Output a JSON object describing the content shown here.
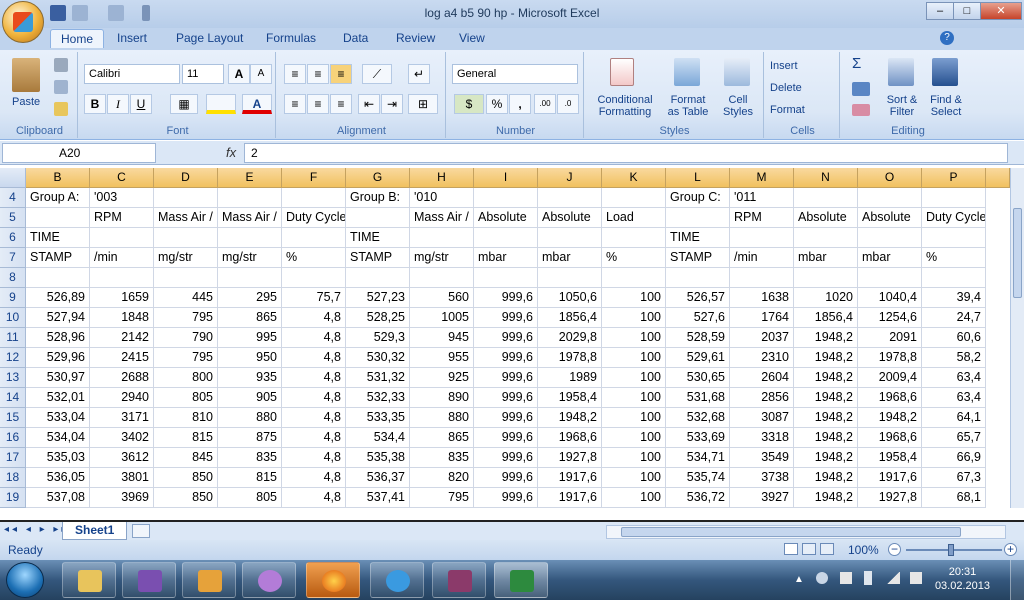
{
  "window": {
    "title": "log a4 b5 90 hp  -  Microsoft Excel",
    "min": "–",
    "max": "□",
    "close": "✕"
  },
  "tabs": [
    "Home",
    "Insert",
    "Page Layout",
    "Formulas",
    "Data",
    "Review",
    "View"
  ],
  "ribbon": {
    "clipboard": {
      "label": "Clipboard",
      "paste": "Paste"
    },
    "font": {
      "label": "Font",
      "name": "Calibri",
      "size": "11",
      "bold": "B",
      "italic": "I",
      "underline": "U",
      "grow": "A",
      "shrink": "A"
    },
    "alignment": {
      "label": "Alignment"
    },
    "number": {
      "label": "Number",
      "format": "General",
      "percent": "%",
      "comma": ","
    },
    "styles": {
      "label": "Styles",
      "conditional": "Conditional",
      "conditional2": "Formatting",
      "format_table": "Format",
      "format_table2": "as Table",
      "cell_styles": "Cell",
      "cell_styles2": "Styles"
    },
    "cells": {
      "label": "Cells",
      "insert": "Insert",
      "delete": "Delete",
      "format": "Format"
    },
    "editing": {
      "label": "Editing",
      "sum": "Σ",
      "sort": "Sort &",
      "sort2": "Filter",
      "find": "Find &",
      "find2": "Select"
    }
  },
  "formula_bar": {
    "name_box": "A20",
    "fx": "fx",
    "value": "2"
  },
  "columns": [
    "B",
    "C",
    "D",
    "E",
    "F",
    "G",
    "H",
    "I",
    "J",
    "K",
    "L",
    "M",
    "N",
    "O",
    "P"
  ],
  "rows": [
    {
      "n": "4",
      "cells": [
        "Group A:",
        "'003",
        "",
        "",
        "",
        "Group B:",
        "'010",
        "",
        "",
        "",
        "Group C:",
        "'011",
        "",
        "",
        ""
      ]
    },
    {
      "n": "5",
      "cells": [
        "",
        "RPM",
        "Mass Air /",
        "Mass Air /",
        "Duty Cycle",
        "",
        "Mass Air /",
        "Absolute",
        "Absolute",
        "Load",
        "",
        "RPM",
        "Absolute",
        "Absolute",
        "Duty Cycle"
      ]
    },
    {
      "n": "6",
      "cells": [
        "TIME",
        "",
        "",
        "",
        "",
        "TIME",
        "",
        "",
        "",
        "",
        "TIME",
        "",
        "",
        "",
        ""
      ]
    },
    {
      "n": "7",
      "cells": [
        "STAMP",
        "/min",
        "mg/str",
        "mg/str",
        "%",
        "STAMP",
        "mg/str",
        "mbar",
        "mbar",
        "%",
        "STAMP",
        "/min",
        "mbar",
        "mbar",
        "%"
      ]
    },
    {
      "n": "8",
      "cells": [
        "",
        "",
        "",
        "",
        "",
        "",
        "",
        "",
        "",
        "",
        "",
        "",
        "",
        "",
        ""
      ]
    },
    {
      "n": "9",
      "cells": [
        "526,89",
        "1659",
        "445",
        "295",
        "75,7",
        "527,23",
        "560",
        "999,6",
        "1050,6",
        "100",
        "526,57",
        "1638",
        "1020",
        "1040,4",
        "39,4"
      ]
    },
    {
      "n": "10",
      "cells": [
        "527,94",
        "1848",
        "795",
        "865",
        "4,8",
        "528,25",
        "1005",
        "999,6",
        "1856,4",
        "100",
        "527,6",
        "1764",
        "1856,4",
        "1254,6",
        "24,7"
      ]
    },
    {
      "n": "11",
      "cells": [
        "528,96",
        "2142",
        "790",
        "995",
        "4,8",
        "529,3",
        "945",
        "999,6",
        "2029,8",
        "100",
        "528,59",
        "2037",
        "1948,2",
        "2091",
        "60,6"
      ]
    },
    {
      "n": "12",
      "cells": [
        "529,96",
        "2415",
        "795",
        "950",
        "4,8",
        "530,32",
        "955",
        "999,6",
        "1978,8",
        "100",
        "529,61",
        "2310",
        "1948,2",
        "1978,8",
        "58,2"
      ]
    },
    {
      "n": "13",
      "cells": [
        "530,97",
        "2688",
        "800",
        "935",
        "4,8",
        "531,32",
        "925",
        "999,6",
        "1989",
        "100",
        "530,65",
        "2604",
        "1948,2",
        "2009,4",
        "63,4"
      ]
    },
    {
      "n": "14",
      "cells": [
        "532,01",
        "2940",
        "805",
        "905",
        "4,8",
        "532,33",
        "890",
        "999,6",
        "1958,4",
        "100",
        "531,68",
        "2856",
        "1948,2",
        "1968,6",
        "63,4"
      ]
    },
    {
      "n": "15",
      "cells": [
        "533,04",
        "3171",
        "810",
        "880",
        "4,8",
        "533,35",
        "880",
        "999,6",
        "1948,2",
        "100",
        "532,68",
        "3087",
        "1948,2",
        "1948,2",
        "64,1"
      ]
    },
    {
      "n": "16",
      "cells": [
        "534,04",
        "3402",
        "815",
        "875",
        "4,8",
        "534,4",
        "865",
        "999,6",
        "1968,6",
        "100",
        "533,69",
        "3318",
        "1948,2",
        "1968,6",
        "65,7"
      ]
    },
    {
      "n": "17",
      "cells": [
        "535,03",
        "3612",
        "845",
        "835",
        "4,8",
        "535,38",
        "835",
        "999,6",
        "1927,8",
        "100",
        "534,71",
        "3549",
        "1948,2",
        "1958,4",
        "66,9"
      ]
    },
    {
      "n": "18",
      "cells": [
        "536,05",
        "3801",
        "850",
        "815",
        "4,8",
        "536,37",
        "820",
        "999,6",
        "1917,6",
        "100",
        "535,74",
        "3738",
        "1948,2",
        "1917,6",
        "67,3"
      ]
    },
    {
      "n": "19",
      "cells": [
        "537,08",
        "3969",
        "850",
        "805",
        "4,8",
        "537,41",
        "795",
        "999,6",
        "1917,6",
        "100",
        "536,72",
        "3927",
        "1948,2",
        "1927,8",
        "68,1"
      ]
    }
  ],
  "sheet_tab": "Sheet1",
  "status": {
    "ready": "Ready",
    "zoom": "100%"
  },
  "clock": {
    "time": "20:31",
    "date": "03.02.2013"
  },
  "colors": {
    "accent": "#15428b",
    "header_orange": "#f1c15f"
  }
}
